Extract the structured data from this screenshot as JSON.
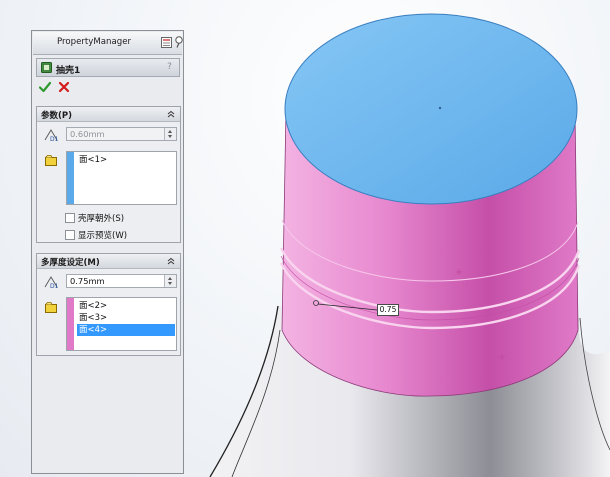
{
  "property_manager": {
    "title": "PropertyManager",
    "feature_title": "抽壳1",
    "help_label": "?",
    "groups": {
      "parameters": {
        "title": "参数(P)",
        "thickness": "0.60mm",
        "faces": [
          "面<1>"
        ],
        "checkboxes": [
          {
            "label": "壳厚朝外(S)",
            "checked": false
          },
          {
            "label": "显示预览(W)",
            "checked": false
          }
        ]
      },
      "multi_thickness": {
        "title": "多厚度设定(M)",
        "thickness": "0.75mm",
        "faces": [
          "面<2>",
          "面<3>",
          "面<4>"
        ],
        "selected_index": 2
      }
    }
  },
  "graphics_area": {
    "dimension_label": "0.75"
  },
  "colors": {
    "top_face": "#6bb6ef",
    "selected_faces": "#e07ac8",
    "ok_green": "#2f9a2f",
    "cancel_red": "#d31b1b",
    "selection_blue": "#3399ff"
  },
  "icons": {
    "header_left": "pin-icon",
    "header_right": "pushpin-icon",
    "feature": "shell-feature-icon",
    "ok": "check-icon",
    "cancel": "cross-icon",
    "collapse": "chevron-up-icon",
    "dimension": "thickness-dimension-icon",
    "faces": "face-selection-icon"
  }
}
